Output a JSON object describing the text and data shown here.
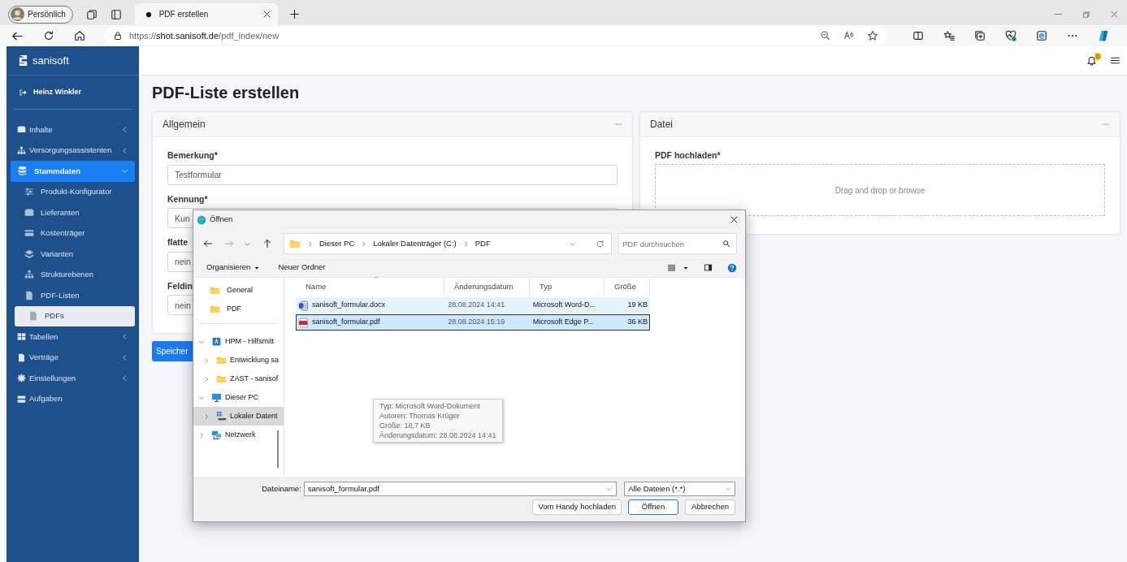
{
  "browser": {
    "profile": "Persönlich",
    "tabs": [
      {
        "title": "PDF erstellen",
        "selected": true
      }
    ],
    "url": {
      "scheme": "https://",
      "host": "shot.sanisoft.de",
      "path": "/pdf_index/new"
    }
  },
  "sidebar": {
    "brand": "sanisoft",
    "user": "Heinz Winkler",
    "items": [
      {
        "label": "Inhalte",
        "expanded": false,
        "selected": false
      },
      {
        "label": "Versorgungsassistenten",
        "expanded": false,
        "selected": false
      },
      {
        "label": "Stammdaten",
        "expanded": true,
        "selected": true,
        "children": [
          {
            "label": "Produkt-Konfigurator",
            "selected": false
          },
          {
            "label": "Lieferanten",
            "selected": false
          },
          {
            "label": "Kostenträger",
            "selected": false
          },
          {
            "label": "Varianten",
            "selected": false
          },
          {
            "label": "Strukturebenen",
            "selected": false
          },
          {
            "label": "PDF-Listen",
            "selected": false
          },
          {
            "label": "PDFs",
            "selected": true
          }
        ]
      },
      {
        "label": "Tabellen",
        "expanded": false,
        "selected": false
      },
      {
        "label": "Verträge",
        "expanded": false,
        "selected": false
      },
      {
        "label": "Einstellungen",
        "expanded": false,
        "selected": false
      },
      {
        "label": "Aufgaben",
        "selected": false
      }
    ]
  },
  "topbar": {
    "notifications": "0"
  },
  "page": {
    "title": "PDF-Liste erstellen"
  },
  "cards": [
    {
      "title": "Allgemein",
      "fields": [
        {
          "label": "Bemerkung*",
          "value": "Testformular"
        },
        {
          "label": "Kennung*",
          "value": "Kun"
        },
        {
          "label": "flatte",
          "value": "nein"
        },
        {
          "label": "Feldin",
          "value": "nein"
        }
      ],
      "button": "Speicher"
    },
    {
      "title": "Datei",
      "upload": {
        "label": "PDF hochladen*",
        "hint": "Drag and drop or browse"
      }
    }
  ],
  "dialog": {
    "title": "Öffnen",
    "path": [
      "Dieser PC",
      "Lokaler Datenträger (C:)",
      "PDF"
    ],
    "search_placeholder": "PDF durchsuchen",
    "toolbar": [
      "Organisieren",
      "Neuer Ordner"
    ],
    "quick_access": [
      {
        "label": "General",
        "selected": false
      },
      {
        "label": "PDF",
        "selected": false
      }
    ],
    "tree": [
      {
        "label": "HPM - Hilfsmitt",
        "kind": "library",
        "expanded": true,
        "selected": false,
        "children": [
          {
            "label": "Entwicklung sa",
            "kind": "folder",
            "expanded": false,
            "selected": false
          },
          {
            "label": "ZAST - sanisof",
            "kind": "folder",
            "expanded": false,
            "selected": false
          }
        ]
      },
      {
        "label": "Dieser PC",
        "kind": "computer",
        "expanded": true,
        "selected": false,
        "children": [
          {
            "label": "Lokaler Datent",
            "kind": "drive",
            "expanded": false,
            "selected": true
          }
        ]
      },
      {
        "label": "Netzwerk",
        "kind": "network",
        "expanded": false,
        "selected": false
      }
    ],
    "columns": [
      "Name",
      "Änderungsdatum",
      "Typ",
      "Größe"
    ],
    "files": [
      {
        "name": "sanisoft_formular.docx",
        "date": "28.08.2024 14:41",
        "type": "Microsoft Word-D...",
        "size": "19 KB",
        "kind": "word",
        "hovered": true,
        "selected": false
      },
      {
        "name": "sanisoft_formular.pdf",
        "date": "28.08.2024 15:19",
        "type": "Microsoft Edge P...",
        "size": "36 KB",
        "kind": "pdf",
        "hovered": false,
        "selected": true
      }
    ],
    "tooltip": [
      "Typ: Microsoft Word-Dokument",
      "Autoren: Thomas Krüger",
      "Größe: 18,7 KB",
      "Änderungsdatum: 28.08.2024 14:41"
    ],
    "filename_label": "Dateiname:",
    "filename": "sanisoft_formular.pdf",
    "filter": "Alle Dateien (*.*)",
    "buttons": [
      {
        "label": "Vom Handy hochladen",
        "default": false
      },
      {
        "label": "Öffnen",
        "default": true
      },
      {
        "label": "Abbrechen",
        "default": false
      }
    ]
  }
}
